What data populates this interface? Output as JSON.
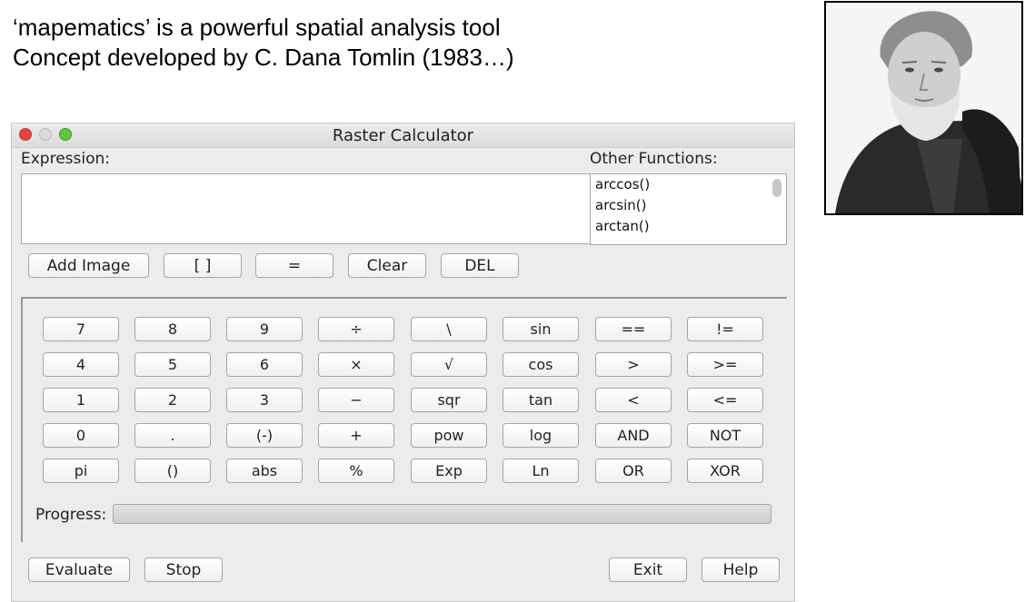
{
  "slide": {
    "line1": "‘mapematics’ is a powerful spatial analysis tool",
    "line2": "Concept developed by C. Dana Tomlin (1983…)"
  },
  "window": {
    "title": "Raster Calculator"
  },
  "expression": {
    "label": "Expression:",
    "value": ""
  },
  "other_functions": {
    "label": "Other Functions:",
    "items": [
      "arccos()",
      "arcsin()",
      "arctan()"
    ]
  },
  "toolbar": {
    "add_image": "Add Image",
    "brackets": "[ ]",
    "equals": "=",
    "clear": "Clear",
    "del": "DEL"
  },
  "keypad": {
    "rows": [
      [
        "7",
        "8",
        "9",
        "÷",
        "\\",
        "sin",
        "==",
        "!="
      ],
      [
        "4",
        "5",
        "6",
        "×",
        "√",
        "cos",
        ">",
        ">="
      ],
      [
        "1",
        "2",
        "3",
        "−",
        "sqr",
        "tan",
        "<",
        "<="
      ],
      [
        "0",
        ".",
        "(-)",
        "+",
        "pow",
        "log",
        "AND",
        "NOT"
      ],
      [
        "pi",
        "()",
        "abs",
        "%",
        "Exp",
        "Ln",
        "OR",
        "XOR"
      ]
    ]
  },
  "progress": {
    "label": "Progress:",
    "fraction": 0
  },
  "footer": {
    "evaluate": "Evaluate",
    "stop": "Stop",
    "exit": "Exit",
    "help": "Help"
  }
}
